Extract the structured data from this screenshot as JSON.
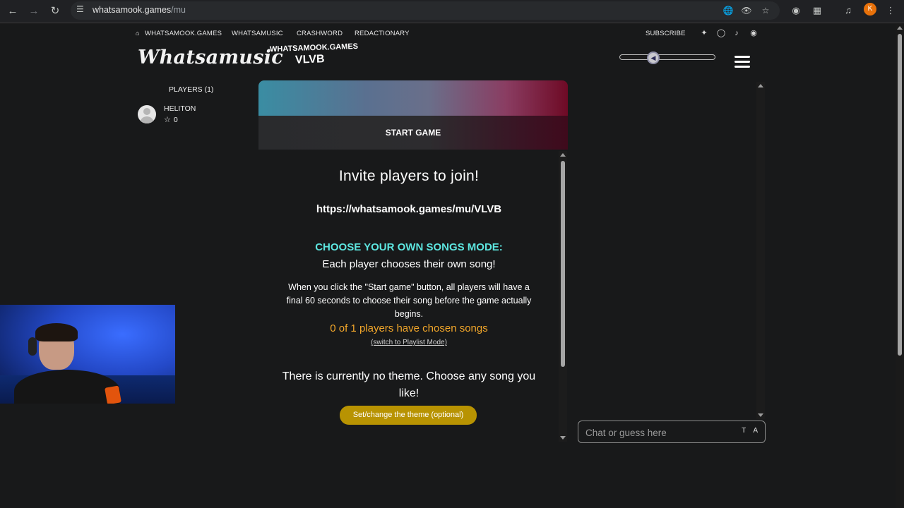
{
  "browser": {
    "url_host": "whatsamook.games",
    "url_path": "/mu",
    "profile_initial": "K"
  },
  "site_nav": {
    "links": [
      "WHATSAMOOK.GAMES",
      "WHATSAMUSIC",
      "CRASHWORD",
      "REDACTIONARY"
    ],
    "subscribe": "SUBSCRIBE"
  },
  "header": {
    "logo": "Whatsamusic",
    "room_site": "WHATSAMOOK.GAMES",
    "room_code": "VLVB",
    "volume_fraction": 0.33
  },
  "players": {
    "title": "PLAYERS (1)",
    "list": [
      {
        "name": "HELITON",
        "score": "0"
      }
    ]
  },
  "game": {
    "start_label": "START GAME",
    "invite_title": "Invite players to join!",
    "invite_url": "https://whatsamook.games/mu/VLVB",
    "mode_title": "CHOOSE YOUR OWN SONGS MODE:",
    "mode_sub": "Each player chooses their own song!",
    "mode_desc": "When you click the \"Start game\" button, all players will have a final 60 seconds to choose their song before the game actually begins.",
    "chosen_status": "0 of 1 players have chosen songs",
    "switch_link": "(switch to Playlist Mode)",
    "theme_text": "There is currently no theme. Choose any song you like!",
    "theme_button": "Set/change the theme (optional)"
  },
  "chat": {
    "placeholder": "Chat or guess here",
    "tools": "T A"
  },
  "colors": {
    "mode_title": "#5de6e0",
    "chosen_status": "#f1a62a",
    "theme_button": "#b89302"
  }
}
